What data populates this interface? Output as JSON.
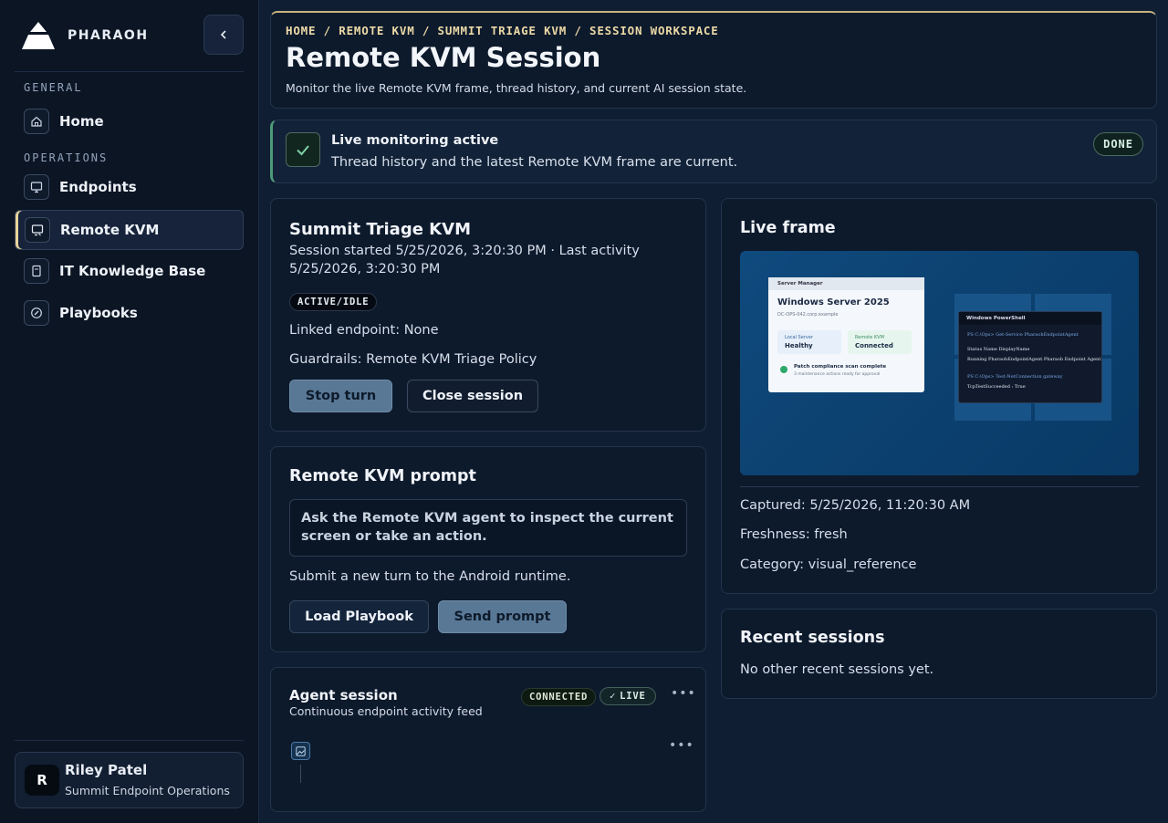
{
  "brand": {
    "name": "PHARAOH"
  },
  "sidebar": {
    "sections": [
      {
        "label": "GENERAL"
      },
      {
        "label": "OPERATIONS"
      }
    ],
    "items": [
      {
        "label": "Home",
        "icon": "home-icon"
      },
      {
        "label": "Endpoints",
        "icon": "monitor-icon"
      },
      {
        "label": "Remote KVM",
        "icon": "remote-screen-icon",
        "active": true
      },
      {
        "label": "IT Knowledge Base",
        "icon": "book-icon"
      },
      {
        "label": "Playbooks",
        "icon": "compass-icon"
      }
    ]
  },
  "user": {
    "initial": "R",
    "name": "Riley Patel",
    "org": "Summit Endpoint Operations"
  },
  "header": {
    "breadcrumb": "HOME / REMOTE KVM / SUMMIT TRIAGE KVM / SESSION WORKSPACE",
    "title": "Remote KVM Session",
    "subtitle": "Monitor the live Remote KVM frame, thread history, and current AI session state."
  },
  "alert": {
    "title": "Live monitoring active",
    "text": "Thread history and the latest Remote KVM frame are current.",
    "badge": "DONE"
  },
  "session": {
    "title": "Summit Triage KVM",
    "started_line1": "Session started 5/25/2026, 3:20:30 PM · Last activity",
    "started_line2": "5/25/2026, 3:20:30 PM",
    "status": "ACTIVE/IDLE",
    "linked_endpoint": "Linked endpoint: None",
    "guardrails": "Guardrails: Remote KVM Triage Policy",
    "stop_label": "Stop turn",
    "close_label": "Close session"
  },
  "prompt": {
    "title": "Remote KVM prompt",
    "placeholder": "Ask the Remote KVM agent to inspect the current screen or take an action.",
    "hint": "Submit a new turn to the Android runtime.",
    "load_label": "Load Playbook",
    "send_label": "Send prompt"
  },
  "agent": {
    "title": "Agent session",
    "subtitle": "Continuous endpoint activity feed",
    "connected": "CONNECTED",
    "live": "LIVE"
  },
  "frame": {
    "title": "Live frame",
    "captured": "Captured: 5/25/2026, 11:20:30 AM",
    "freshness": "Freshness: fresh",
    "category": "Category: visual_reference",
    "screenshot": {
      "server_manager_bar": "Server Manager",
      "server_title": "Windows Server 2025",
      "server_host": "DC-OPS-042.corp.example",
      "local_label": "Local Server",
      "local_value": "Healthy",
      "kvm_label": "Remote KVM",
      "kvm_value": "Connected",
      "patch_title": "Patch compliance scan complete",
      "patch_sub": "3 maintenance actions ready for approval",
      "ps_bar": "Windows PowerShell",
      "ps_line1": "PS C:\\Ops> Get-Service PharaohEndpointAgent",
      "ps_line2": "Status Name DisplayName",
      "ps_line3": "Running PharaohEndpointAgent Pharaoh Endpoint Agent",
      "ps_line4": "PS C:\\Ops> Test-NetConnection gateway",
      "ps_line5": "TcpTestSucceeded : True"
    }
  },
  "recent": {
    "title": "Recent sessions",
    "empty": "No other recent sessions yet."
  }
}
